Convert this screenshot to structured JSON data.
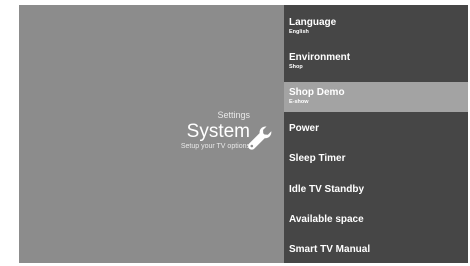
{
  "left_panel": {
    "settings_label": "Settings",
    "title": "System",
    "subtitle": "Setup your TV options",
    "icon": "wrench-icon"
  },
  "menu": {
    "items": [
      {
        "label": "Language",
        "sub": "English"
      },
      {
        "label": "Environment",
        "sub": "Shop"
      },
      {
        "label": "Shop Demo",
        "sub": "E-show",
        "selected": true
      },
      {
        "label": "Power",
        "sub": ""
      },
      {
        "label": "Sleep Timer",
        "sub": ""
      },
      {
        "label": "Idle TV Standby",
        "sub": ""
      },
      {
        "label": "Available space",
        "sub": ""
      },
      {
        "label": "Smart TV Manual",
        "sub": ""
      }
    ]
  },
  "colors": {
    "left_bg": "#8c8c8c",
    "menu_bg": "#464646",
    "selected_bg": "#a3a3a3",
    "text": "#ffffff"
  }
}
